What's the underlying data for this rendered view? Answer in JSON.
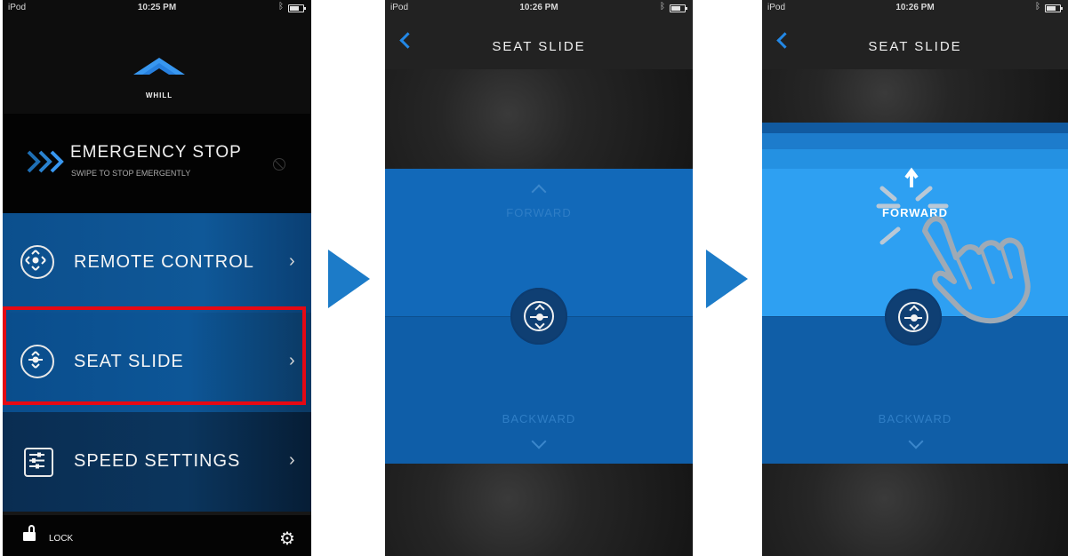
{
  "screens": [
    {
      "status": {
        "carrier": "iPod",
        "time": "10:25 PM"
      },
      "logo_text": "WHILL",
      "emergency": {
        "title": "EMERGENCY STOP",
        "subtitle": "SWIPE TO STOP EMERGENTLY"
      },
      "menu": [
        {
          "label": "REMOTE CONTROL",
          "icon": "remote-control-icon"
        },
        {
          "label": "SEAT SLIDE",
          "icon": "seat-slide-icon"
        },
        {
          "label": "SPEED SETTINGS",
          "icon": "speed-settings-icon"
        }
      ],
      "bottom": {
        "lock_label": "LOCK",
        "settings_icon": "gear-icon"
      },
      "highlight_color": "#e50914"
    },
    {
      "status": {
        "carrier": "iPod",
        "time": "10:26 PM"
      },
      "nav_title": "SEAT SLIDE",
      "forward_label": "FORWARD",
      "backward_label": "BACKWARD"
    },
    {
      "status": {
        "carrier": "iPod",
        "time": "10:26 PM"
      },
      "nav_title": "SEAT SLIDE",
      "forward_label": "FORWARD",
      "backward_label": "BACKWARD"
    }
  ],
  "colors": {
    "accent_blue": "#1c7bc8",
    "nav_back_blue": "#2388e6",
    "active_blue": "#2ea0f2"
  },
  "icons": {
    "flow_arrow": "play-triangle-icon",
    "back": "chevron-left-icon",
    "hand": "tap-hand-icon"
  }
}
